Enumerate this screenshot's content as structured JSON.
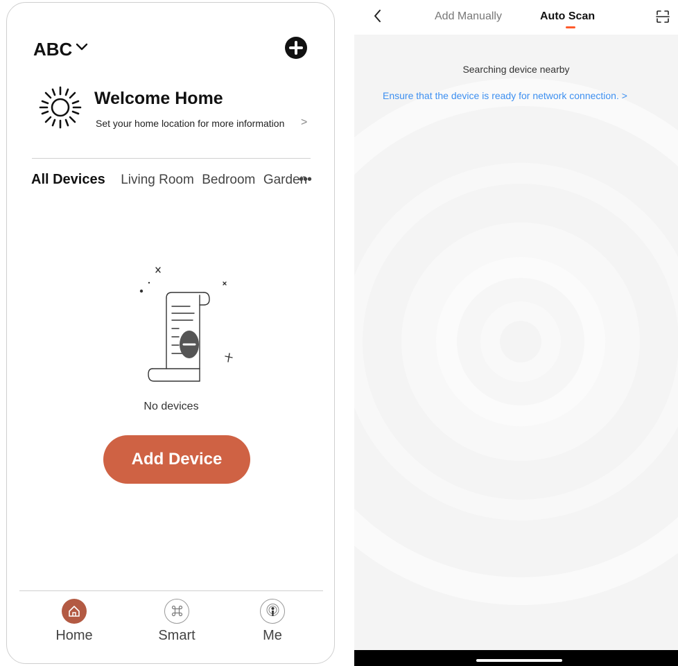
{
  "left": {
    "home_name": "ABC",
    "welcome_title": "Welcome Home",
    "welcome_subtitle": "Set your home location for more information",
    "welcome_arrow": ">",
    "tabs": {
      "all": "All Devices",
      "rooms": [
        "Living Room",
        "Bedroom",
        "Garden"
      ],
      "more": "•••"
    },
    "empty_text": "No devices",
    "add_device_label": "Add Device",
    "nav": [
      {
        "label": "Home",
        "icon": "home-icon",
        "active": true
      },
      {
        "label": "Smart",
        "icon": "command-icon",
        "active": false
      },
      {
        "label": "Me",
        "icon": "person-icon",
        "active": false
      }
    ],
    "colors": {
      "accent": "#cf6244",
      "nav_active": "#b35a43"
    }
  },
  "right": {
    "tab_manual": "Add Manually",
    "tab_auto": "Auto Scan",
    "searching_text": "Searching device nearby",
    "ensure_link": "Ensure that the device is ready for network connection. >",
    "colors": {
      "link": "#3d8ff0",
      "tab_indicator": "#ff5a2b"
    }
  }
}
